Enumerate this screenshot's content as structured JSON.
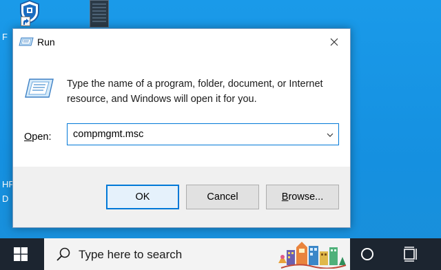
{
  "desktop": {
    "partial_labels": [
      "F",
      "HF",
      "D"
    ]
  },
  "run_dialog": {
    "title": "Run",
    "description": "Type the name of a program, folder, document, or Internet resource, and Windows will open it for you.",
    "open_label_access_key": "O",
    "open_label_rest": "pen:",
    "open_value": "compmgmt.msc",
    "buttons": {
      "ok": "OK",
      "cancel": "Cancel",
      "browse_access_key": "B",
      "browse_rest": "rowse..."
    }
  },
  "taskbar": {
    "search_placeholder": "Type here to search"
  },
  "icons": {
    "start": "windows-logo-icon",
    "search": "search-icon",
    "cortana": "cortana-circle-icon",
    "task_view": "task-view-icon",
    "close": "close-icon",
    "run": "run-icon",
    "dropdown": "chevron-down-icon"
  },
  "colors": {
    "desktop": "#1795e6",
    "taskbar": "#1c2530",
    "accent": "#0078d7"
  }
}
